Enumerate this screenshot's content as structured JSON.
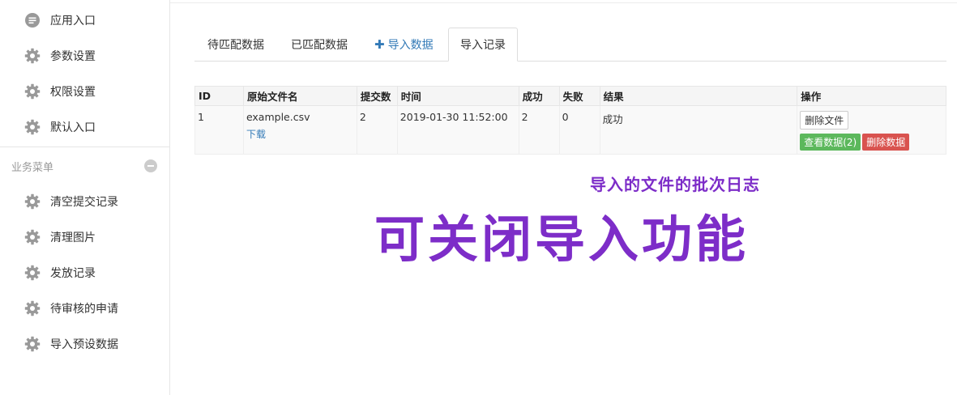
{
  "sidebar": {
    "items_top": [
      {
        "label": "应用入口",
        "icon": "chat-bubble-icon"
      },
      {
        "label": "参数设置",
        "icon": "gear-icon"
      },
      {
        "label": "权限设置",
        "icon": "gear-icon"
      },
      {
        "label": "默认入口",
        "icon": "gear-icon"
      }
    ],
    "section_title": "业务菜单",
    "items_section": [
      {
        "label": "清空提交记录",
        "icon": "gear-icon"
      },
      {
        "label": "清理图片",
        "icon": "gear-icon"
      },
      {
        "label": "发放记录",
        "icon": "gear-icon"
      },
      {
        "label": "待审核的申请",
        "icon": "gear-icon"
      },
      {
        "label": "导入预设数据",
        "icon": "gear-icon"
      }
    ]
  },
  "tabs": [
    {
      "label": "待匹配数据"
    },
    {
      "label": "已匹配数据"
    },
    {
      "label": "导入数据",
      "icon": "plus-icon"
    },
    {
      "label": "导入记录",
      "active": true
    }
  ],
  "table": {
    "headers": [
      "ID",
      "原始文件名",
      "提交数",
      "时间",
      "成功",
      "失败",
      "结果",
      "操作"
    ],
    "rows": [
      {
        "id": "1",
        "filename": "example.csv",
        "download": "下载",
        "submitted": "2",
        "time": "2019-01-30 11:52:00",
        "success": "2",
        "failed": "0",
        "result": "成功",
        "delete_file": "删除文件",
        "view_data": "查看数据(2)",
        "delete_data": "删除数据"
      }
    ]
  },
  "annotations": {
    "subtitle": "导入的文件的批次日志",
    "title": "可关闭导入功能"
  },
  "colors": {
    "annotation": "#7d2dc8",
    "link": "#337ab7",
    "success_button": "#5cb85c",
    "danger_button": "#d9534f"
  }
}
